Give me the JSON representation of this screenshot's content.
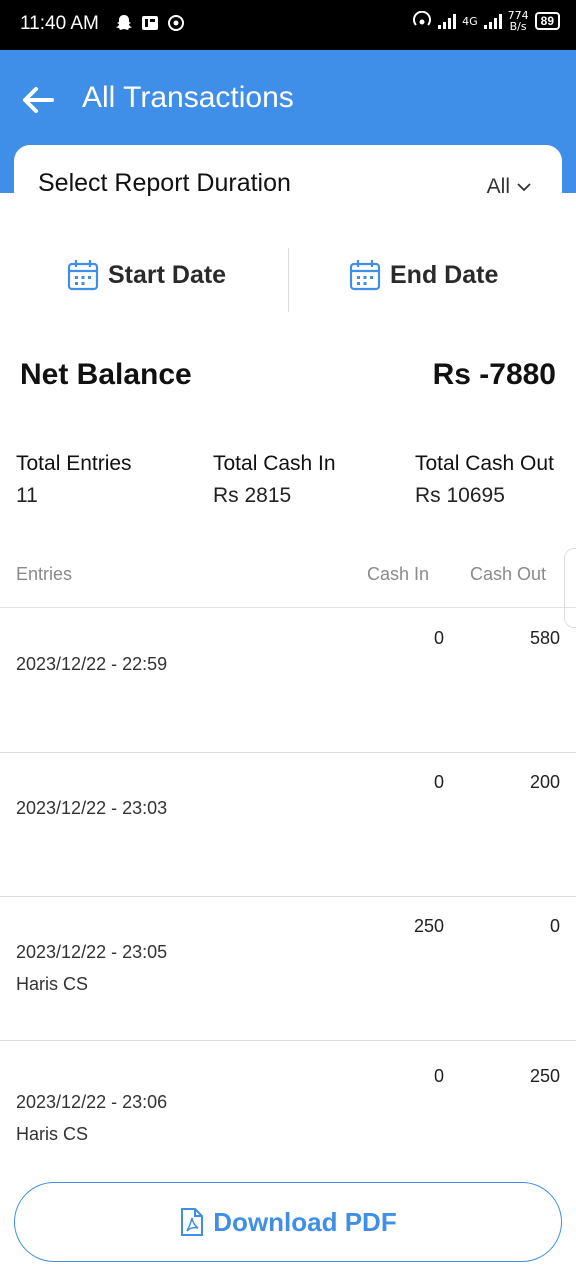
{
  "status_bar": {
    "time": "11:40 AM",
    "network_speed": "774",
    "network_unit": "B/s",
    "network_type": "4G",
    "battery": "89"
  },
  "header": {
    "title": "All Transactions"
  },
  "report": {
    "duration_label": "Select Report Duration",
    "duration_value": "All"
  },
  "dates": {
    "start_label": "Start Date",
    "end_label": "End Date"
  },
  "summary": {
    "net_label": "Net Balance",
    "net_value": "Rs -7880",
    "total_entries_label": "Total Entries",
    "total_entries_value": "11",
    "total_cash_in_label": "Total Cash In",
    "total_cash_in_value": "Rs 2815",
    "total_cash_out_label": "Total Cash Out",
    "total_cash_out_value": "Rs 10695"
  },
  "table": {
    "headers": [
      "Entries",
      "Cash In",
      "Cash Out"
    ],
    "rows": [
      {
        "datetime": "2023/12/22 - 22:59",
        "note": "",
        "cash_in": "0",
        "cash_out": "580"
      },
      {
        "datetime": "2023/12/22 - 23:03",
        "note": "",
        "cash_in": "0",
        "cash_out": "200"
      },
      {
        "datetime": "2023/12/22 - 23:05",
        "note": "Haris CS",
        "cash_in": "250",
        "cash_out": "0"
      },
      {
        "datetime": "2023/12/22 - 23:06",
        "note": "Haris CS",
        "cash_in": "0",
        "cash_out": "250"
      }
    ]
  },
  "actions": {
    "download_label": "Download PDF"
  },
  "colors": {
    "primary": "#3f8fe8",
    "status_bar": "#000000"
  }
}
